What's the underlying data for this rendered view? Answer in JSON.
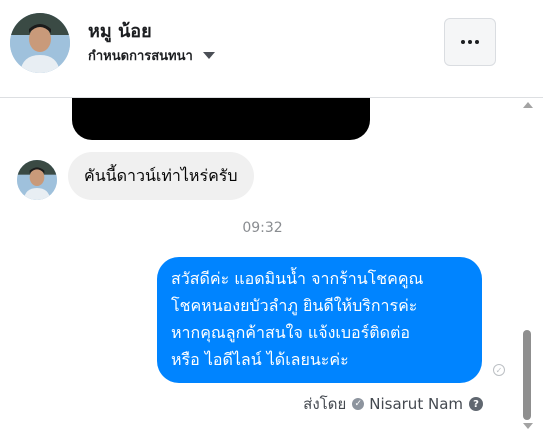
{
  "header": {
    "contact_name": "หมู น้อย",
    "subtitle": "กำหนดการสนทนา",
    "more_icon": "more-horizontal-icon",
    "caret_icon": "caret-down-icon"
  },
  "messages": {
    "incoming_text": "คันนี้ดาวน์เท่าไหร่ครับ",
    "timestamp": "09:32",
    "outgoing_lines": [
      "สวัสดีค่ะ แอดมินน้ำ จากร้านโชคคูณ",
      "โชคหนองยบัวลำภู ยินดีให้บริการค่ะ",
      "หากคุณลูกค้าสนใจ แจ้งเบอร์ติดต่อ",
      "หรือ ไอดีไลน์ ได้เลยนะค่ะ"
    ]
  },
  "footer": {
    "sent_by_label": "ส่งโดย",
    "sender_name": "Nisarut Nam",
    "help_glyph": "?"
  },
  "colors": {
    "outgoing_bubble": "#0084ff",
    "incoming_bubble": "#f0f0f0",
    "timestamp": "#8a8d91"
  }
}
